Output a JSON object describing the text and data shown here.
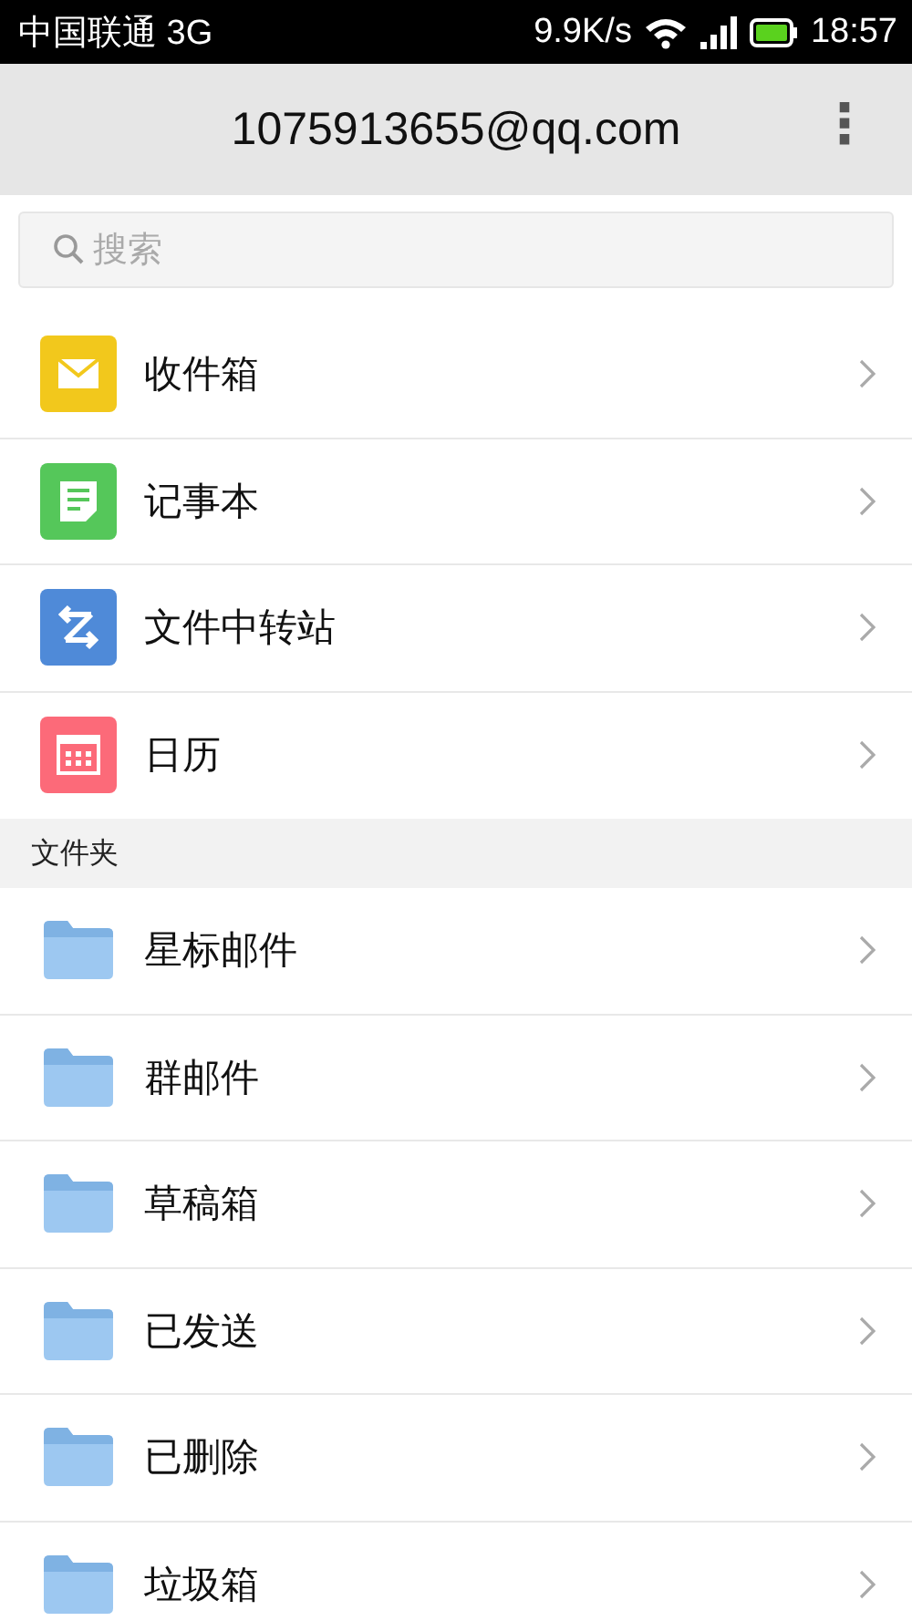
{
  "status_bar": {
    "carrier": "中国联通 3G",
    "speed": "9.9K/s",
    "time": "18:57"
  },
  "header": {
    "title": "1075913655@qq.com",
    "menu": "⋮"
  },
  "search": {
    "placeholder": "搜索"
  },
  "apps": [
    {
      "kind": "mail",
      "label": "收件箱"
    },
    {
      "kind": "note",
      "label": "记事本"
    },
    {
      "kind": "transfer",
      "label": "文件中转站"
    },
    {
      "kind": "calendar",
      "label": "日历"
    }
  ],
  "folders_section": {
    "title": "文件夹",
    "items": [
      {
        "kind": "folder",
        "label": "星标邮件"
      },
      {
        "kind": "folder",
        "label": "群邮件"
      },
      {
        "kind": "folder",
        "label": "草稿箱"
      },
      {
        "kind": "folder",
        "label": "已发送"
      },
      {
        "kind": "folder",
        "label": "已删除"
      },
      {
        "kind": "folder",
        "label": "垃圾箱"
      }
    ]
  }
}
